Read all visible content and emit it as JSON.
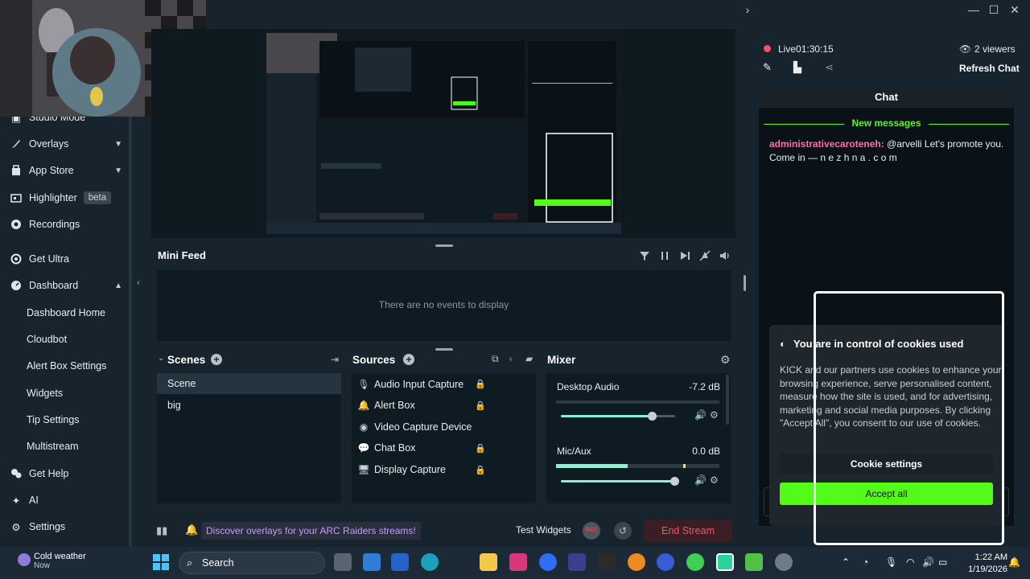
{
  "colors": {
    "accent": "#80f5d2",
    "kick_green": "#53fc18",
    "live_red": "#ff4f63",
    "promo_purple": "#c49bff"
  },
  "sidebar": {
    "studio_mode": "Studio Mode",
    "items": [
      {
        "label": "Overlays",
        "icon": "brush-icon"
      },
      {
        "label": "App Store",
        "icon": "store-icon"
      },
      {
        "label": "Highlighter",
        "icon": "highlighter-icon",
        "badge": "beta"
      },
      {
        "label": "Recordings",
        "icon": "record-icon"
      },
      {
        "label": "Get Ultra",
        "icon": "ultra-icon"
      },
      {
        "label": "Dashboard",
        "icon": "dashboard-icon"
      },
      {
        "label": "Get Help",
        "icon": "help-icon"
      },
      {
        "label": "AI",
        "icon": "ai-icon"
      },
      {
        "label": "Settings",
        "icon": "gear-icon"
      }
    ],
    "dashboard_sub": [
      "Dashboard Home",
      "Cloudbot",
      "Alert Box Settings",
      "Widgets",
      "Tip Settings",
      "Multistream"
    ]
  },
  "minifeed": {
    "title": "Mini Feed",
    "empty": "There are no events to display"
  },
  "scenes": {
    "title": "Scenes",
    "items": [
      "Scene",
      "big"
    ]
  },
  "sources": {
    "title": "Sources",
    "items": [
      {
        "label": "Audio Input Capture",
        "icon": "mic-icon",
        "locked": true
      },
      {
        "label": "Alert Box",
        "icon": "bell-icon",
        "locked": true
      },
      {
        "label": "Video Capture Device",
        "icon": "camera-icon",
        "locked": false
      },
      {
        "label": "Chat Box",
        "icon": "chat-icon",
        "locked": true
      },
      {
        "label": "Display Capture",
        "icon": "monitor-icon",
        "locked": true
      }
    ]
  },
  "mixer": {
    "title": "Mixer",
    "channels": [
      {
        "name": "Desktop Audio",
        "db": "-7.2 dB",
        "level": 0.8
      },
      {
        "name": "Mic/Aux",
        "db": "0.0 dB",
        "level": 1.0
      }
    ]
  },
  "bottom": {
    "promo": "Discover overlays for your ARC Raiders streams!",
    "test_widgets": "Test Widgets",
    "rec": "REC",
    "end_stream": "End Stream"
  },
  "stream": {
    "live": "Live01:30:15",
    "viewers": "2 viewers",
    "refresh_chat": "Refresh Chat"
  },
  "chat": {
    "title": "Chat",
    "new_messages": "New messages",
    "message_user": "administrativecaroteneh:",
    "message_text": " @arvelli Let's promote you. Come in — n e z h  n a . c o m"
  },
  "cookie": {
    "title": "You are in control of cookies used",
    "text": "KICK and our partners use cookies to enhance your browsing experience, serve personalised content, measure how the site is used, and for advertising, marketing and social media purposes. By clicking \"Accept All\", you consent to our use of cookies.",
    "settings_btn": "Cookie settings",
    "accept_btn": "Accept all"
  },
  "taskbar": {
    "weather_title": "Cold weather",
    "weather_sub": "Now",
    "search": "Search",
    "time": "1:22 AM",
    "date": "1/19/2026"
  }
}
